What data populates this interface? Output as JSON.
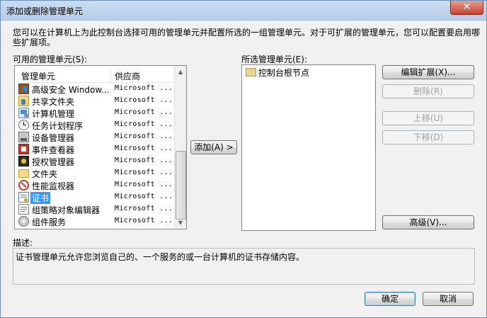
{
  "window": {
    "title": "添加或删除管理单元",
    "close_glyph": "✕"
  },
  "intro_text": "您可以在计算机上为此控制台选择可用的管理单元并配置所选的一组管理单元。对于可扩展的管理单元，您可以配置要启用哪些扩展项。",
  "available": {
    "label": "可用的管理单元(S):",
    "columns": [
      "管理单元",
      "供应商"
    ],
    "rows": [
      {
        "name": "高级安全 Window...",
        "vendor": "Microsoft ...",
        "icon": "firewall-icon"
      },
      {
        "name": "共享文件夹",
        "vendor": "Microsoft ...",
        "icon": "shared-folder-icon"
      },
      {
        "name": "计算机管理",
        "vendor": "Microsoft ...",
        "icon": "computer-management-icon"
      },
      {
        "name": "任务计划程序",
        "vendor": "Microsoft ...",
        "icon": "task-scheduler-icon"
      },
      {
        "name": "设备管理器",
        "vendor": "Microsoft ...",
        "icon": "device-manager-icon"
      },
      {
        "name": "事件查看器",
        "vendor": "Microsoft ...",
        "icon": "event-viewer-icon"
      },
      {
        "name": "授权管理器",
        "vendor": "Microsoft ...",
        "icon": "authorization-manager-icon"
      },
      {
        "name": "文件夹",
        "vendor": "Microsoft ...",
        "icon": "folder-icon"
      },
      {
        "name": "性能监视器",
        "vendor": "Microsoft ...",
        "icon": "performance-monitor-icon"
      },
      {
        "name": "证书",
        "vendor": "Microsoft ...",
        "icon": "certificates-icon",
        "selected": true
      },
      {
        "name": "组策略对象编辑器",
        "vendor": "Microsoft ...",
        "icon": "group-policy-icon"
      },
      {
        "name": "组件服务",
        "vendor": "Microsoft ...",
        "icon": "component-services-icon"
      }
    ]
  },
  "add_button": "添加(A) >",
  "selected": {
    "label": "所选管理单元(E):",
    "tree_root": "控制台根节点"
  },
  "side_buttons": {
    "edit_extensions": "编辑扩展(X)...",
    "remove": "删除(R)",
    "move_up": "上移(U)",
    "move_down": "下移(D)",
    "advanced": "高级(V)..."
  },
  "description": {
    "label": "描述:",
    "text": "证书管理单元允许您浏览自己的、一个服务的或一台计算机的证书存储内容。"
  },
  "footer": {
    "ok": "确定",
    "cancel": "取消"
  },
  "colors": {
    "selection": "#3399ff",
    "title_bar": "#c9dcf2"
  }
}
